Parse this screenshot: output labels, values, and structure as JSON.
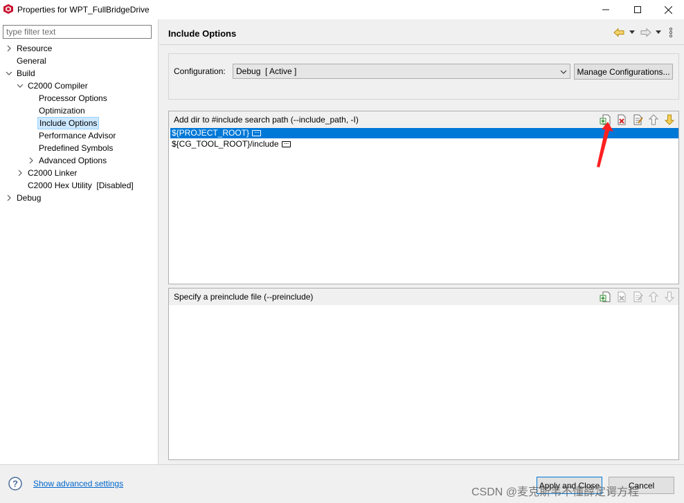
{
  "window": {
    "title": "Properties for WPT_FullBridgeDrive",
    "minimize_icon": "minimize-icon",
    "maximize_icon": "maximize-icon",
    "close_icon": "close-icon"
  },
  "left_pane": {
    "filter_placeholder": "type filter text",
    "tree": [
      {
        "label": "Resource",
        "chevron": "right"
      },
      {
        "label": "General",
        "chevron": "none"
      },
      {
        "label": "Build",
        "chevron": "down"
      },
      {
        "label": "C2000 Compiler",
        "chevron": "down"
      },
      {
        "label": "Processor Options",
        "chevron": "none"
      },
      {
        "label": "Optimization",
        "chevron": "none"
      },
      {
        "label": "Include Options",
        "chevron": "none",
        "selected": true
      },
      {
        "label": "Performance Advisor",
        "chevron": "none"
      },
      {
        "label": "Predefined Symbols",
        "chevron": "none"
      },
      {
        "label": "Advanced Options",
        "chevron": "right"
      },
      {
        "label": "C2000 Linker",
        "chevron": "right"
      },
      {
        "label": "C2000 Hex Utility  [Disabled]",
        "chevron": "none"
      },
      {
        "label": "Debug",
        "chevron": "right"
      }
    ]
  },
  "header": {
    "title": "Include Options",
    "nav_icons": [
      "back-arrow-icon",
      "dropdown-icon",
      "forward-arrow-icon",
      "dropdown-icon",
      "more-vertical-icon"
    ]
  },
  "configuration": {
    "label": "Configuration:",
    "selected": "Debug  [ Active ]",
    "manage_button": "Manage Configurations..."
  },
  "include_path": {
    "title": "Add dir to #include search path (--include_path, -I)",
    "tools": [
      "add-icon",
      "delete-icon",
      "edit-icon",
      "move-up-icon",
      "move-down-icon"
    ],
    "items": [
      {
        "text": "${PROJECT_ROOT}",
        "selected": true
      },
      {
        "text": "${CG_TOOL_ROOT}/include",
        "selected": false
      }
    ]
  },
  "preinclude": {
    "title": "Specify a preinclude file (--preinclude)",
    "tools": [
      "add-icon",
      "delete-icon",
      "edit-icon",
      "move-up-icon",
      "move-down-icon"
    ],
    "items": []
  },
  "footer": {
    "advanced_link": "Show advanced settings",
    "apply_close": "Apply and Close",
    "cancel": "Cancel"
  },
  "watermark": "CSDN @麦克斯韦不懂薛定谔方程",
  "colors": {
    "selection": "#0078d7",
    "tree_selection": "#cce8ff",
    "link": "#0066cc",
    "annotation_arrow": "#ff2020"
  }
}
